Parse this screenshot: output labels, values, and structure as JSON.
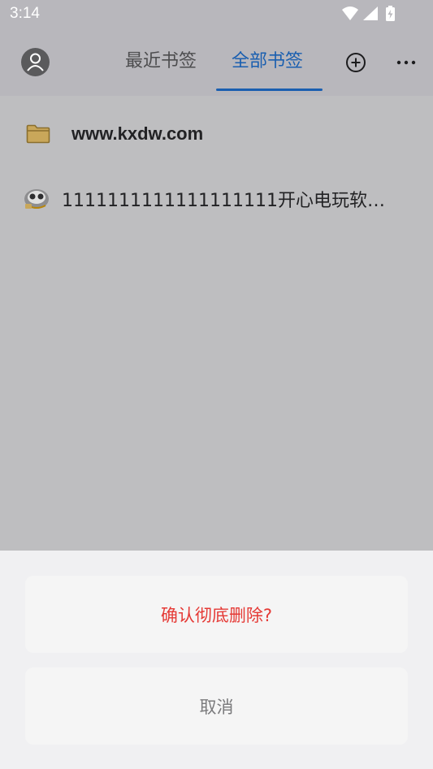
{
  "status_bar": {
    "time": "3:14",
    "icons": [
      "wifi-icon",
      "cellular-signal-icon",
      "battery-charging-icon"
    ]
  },
  "app_bar": {
    "tabs": [
      {
        "label": "最近书签",
        "active": false
      },
      {
        "label": "全部书签",
        "active": true
      }
    ],
    "accent_color": "#1a5fb0",
    "icons": [
      "avatar-icon",
      "add-circle-icon",
      "more-horizontal-icon"
    ]
  },
  "bookmarks": [
    {
      "type": "folder",
      "label": "www.kxdw.com",
      "icon": "folder-icon"
    },
    {
      "type": "bookmark",
      "label": "1111111111111111111开心电玩软…",
      "icon": "site-favicon"
    }
  ],
  "dialog": {
    "confirm_label": "确认彻底删除?",
    "cancel_label": "取消",
    "confirm_color": "#e53935"
  }
}
